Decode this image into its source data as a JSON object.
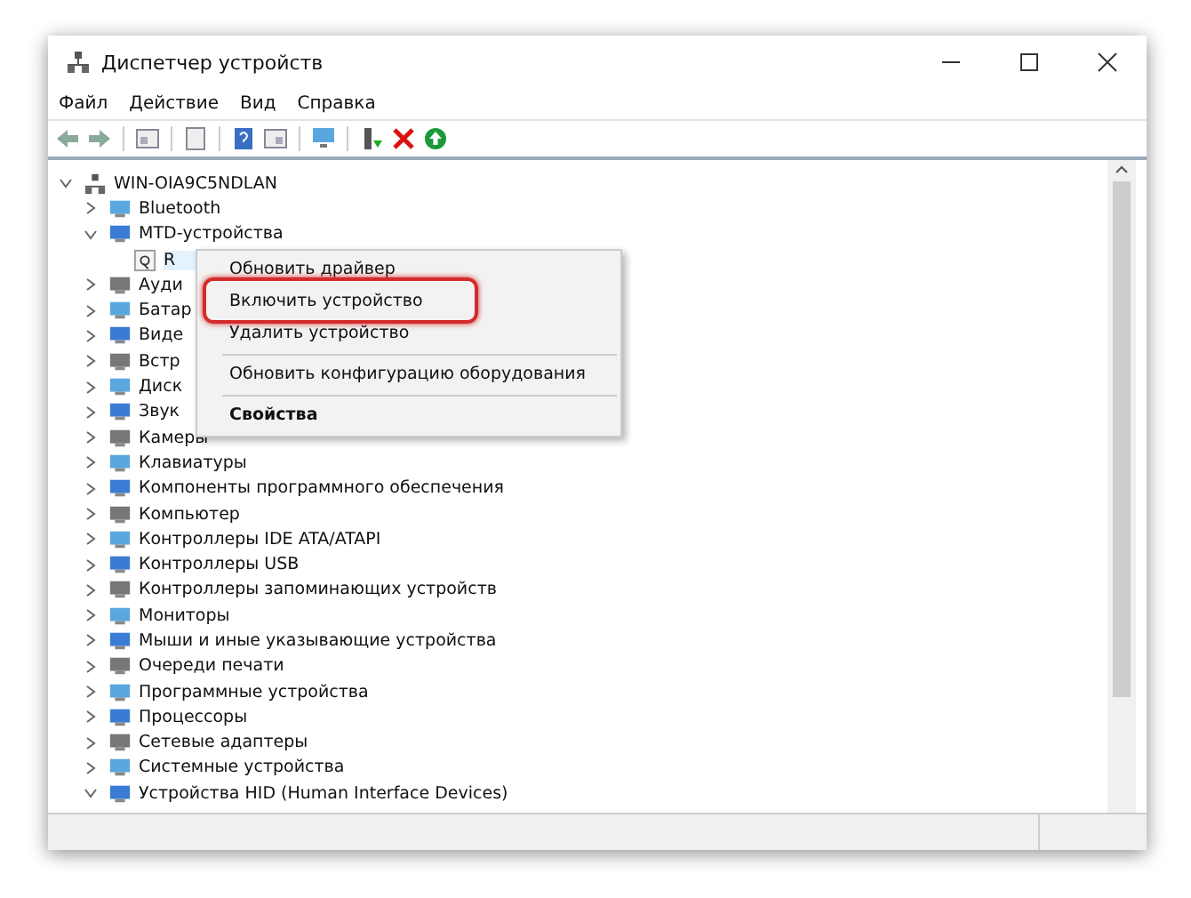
{
  "window": {
    "title": "Диспетчер устройств"
  },
  "menu_bar": [
    "Файл",
    "Действие",
    "Вид",
    "Справка"
  ],
  "tree": {
    "label": "WIN-OIA9C5NDLAN",
    "expanded": true,
    "children": [
      {
        "label": "Bluetooth",
        "expanded": false
      },
      {
        "label": "MTD-устройства",
        "expanded": true,
        "children": [
          {
            "label": "R",
            "selected": true
          }
        ]
      },
      {
        "label": "Ауди",
        "expanded": false
      },
      {
        "label": "Батар",
        "expanded": false
      },
      {
        "label": "Виде",
        "expanded": false
      },
      {
        "label": "Встр",
        "expanded": false
      },
      {
        "label": "Диск",
        "expanded": false
      },
      {
        "label": "Звук",
        "expanded": false
      },
      {
        "label": "Камеры",
        "expanded": false
      },
      {
        "label": "Клавиатуры",
        "expanded": false
      },
      {
        "label": "Компоненты программного обеспечения",
        "expanded": false
      },
      {
        "label": "Компьютер",
        "expanded": false
      },
      {
        "label": "Контроллеры IDE ATA/ATAPI",
        "expanded": false
      },
      {
        "label": "Контроллеры USB",
        "expanded": false
      },
      {
        "label": "Контроллеры запоминающих устройств",
        "expanded": false
      },
      {
        "label": "Мониторы",
        "expanded": false
      },
      {
        "label": "Мыши и иные указывающие устройства",
        "expanded": false
      },
      {
        "label": "Очереди печати",
        "expanded": false
      },
      {
        "label": "Программные устройства",
        "expanded": false
      },
      {
        "label": "Процессоры",
        "expanded": false
      },
      {
        "label": "Сетевые адаптеры",
        "expanded": false
      },
      {
        "label": "Системные устройства",
        "expanded": false
      },
      {
        "label": "Устройства HID (Human Interface Devices)",
        "expanded": true
      }
    ]
  },
  "context_menu": [
    {
      "kind": "item",
      "label": "Обновить драйвер",
      "highlighted": false
    },
    {
      "kind": "item",
      "label": "Включить устройство",
      "highlighted": true
    },
    {
      "kind": "item",
      "label": "Удалить устройство",
      "highlighted": false
    },
    {
      "kind": "separator"
    },
    {
      "kind": "item",
      "label": "Обновить конфигурацию оборудования",
      "highlighted": false
    },
    {
      "kind": "separator"
    },
    {
      "kind": "default",
      "label": "Свойства",
      "highlighted": false
    }
  ]
}
